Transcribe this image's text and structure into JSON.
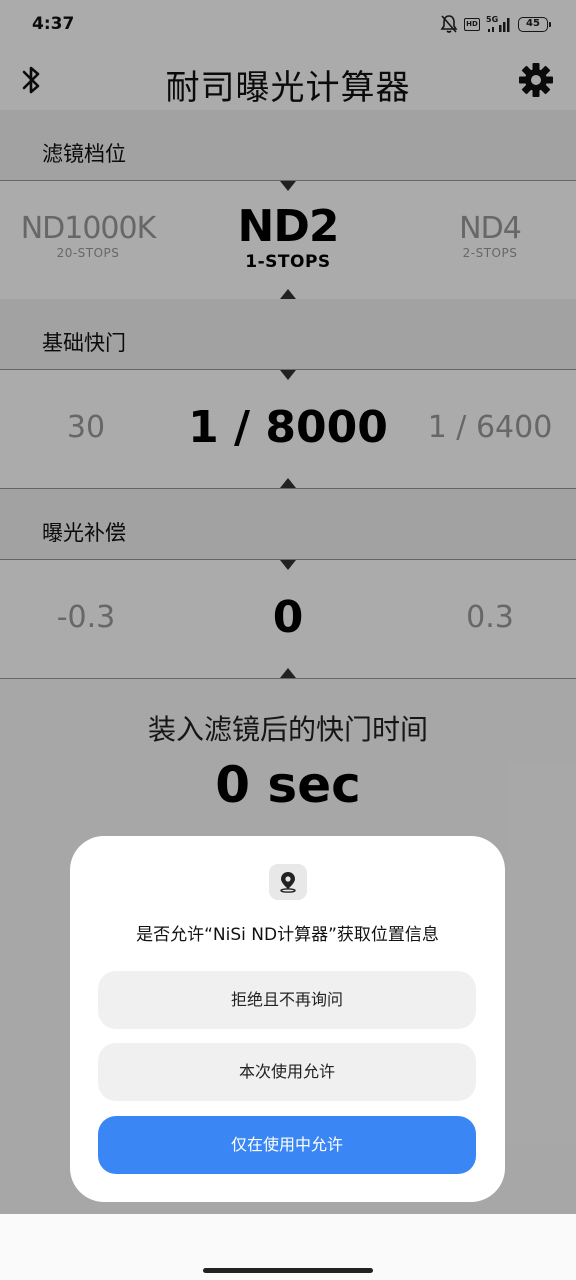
{
  "status_bar": {
    "time": "4:37",
    "battery": "45"
  },
  "header": {
    "title": "耐司曝光计算器"
  },
  "filter": {
    "label": "滤镜档位",
    "left": {
      "main": "ND1000K",
      "sub": "20-STOPS"
    },
    "center": {
      "main": "ND2",
      "sub": "1-STOPS"
    },
    "right": {
      "main": "ND4",
      "sub": "2-STOPS"
    }
  },
  "shutter": {
    "label": "基础快门",
    "left": "30",
    "center": "1 / 8000",
    "right": "1 / 6400"
  },
  "compensation": {
    "label": "曝光补偿",
    "left": "-0.3",
    "center": "0",
    "right": "0.3"
  },
  "result": {
    "label": "装入滤镜后的快门时间",
    "value": "0 sec"
  },
  "dialog": {
    "message": "是否允许“NiSi ND计算器”获取位置信息",
    "deny_label": "拒绝且不再询问",
    "once_label": "本次使用允许",
    "while_using_label": "仅在使用中允许"
  },
  "colors": {
    "primary_button": "#3a86f5"
  }
}
